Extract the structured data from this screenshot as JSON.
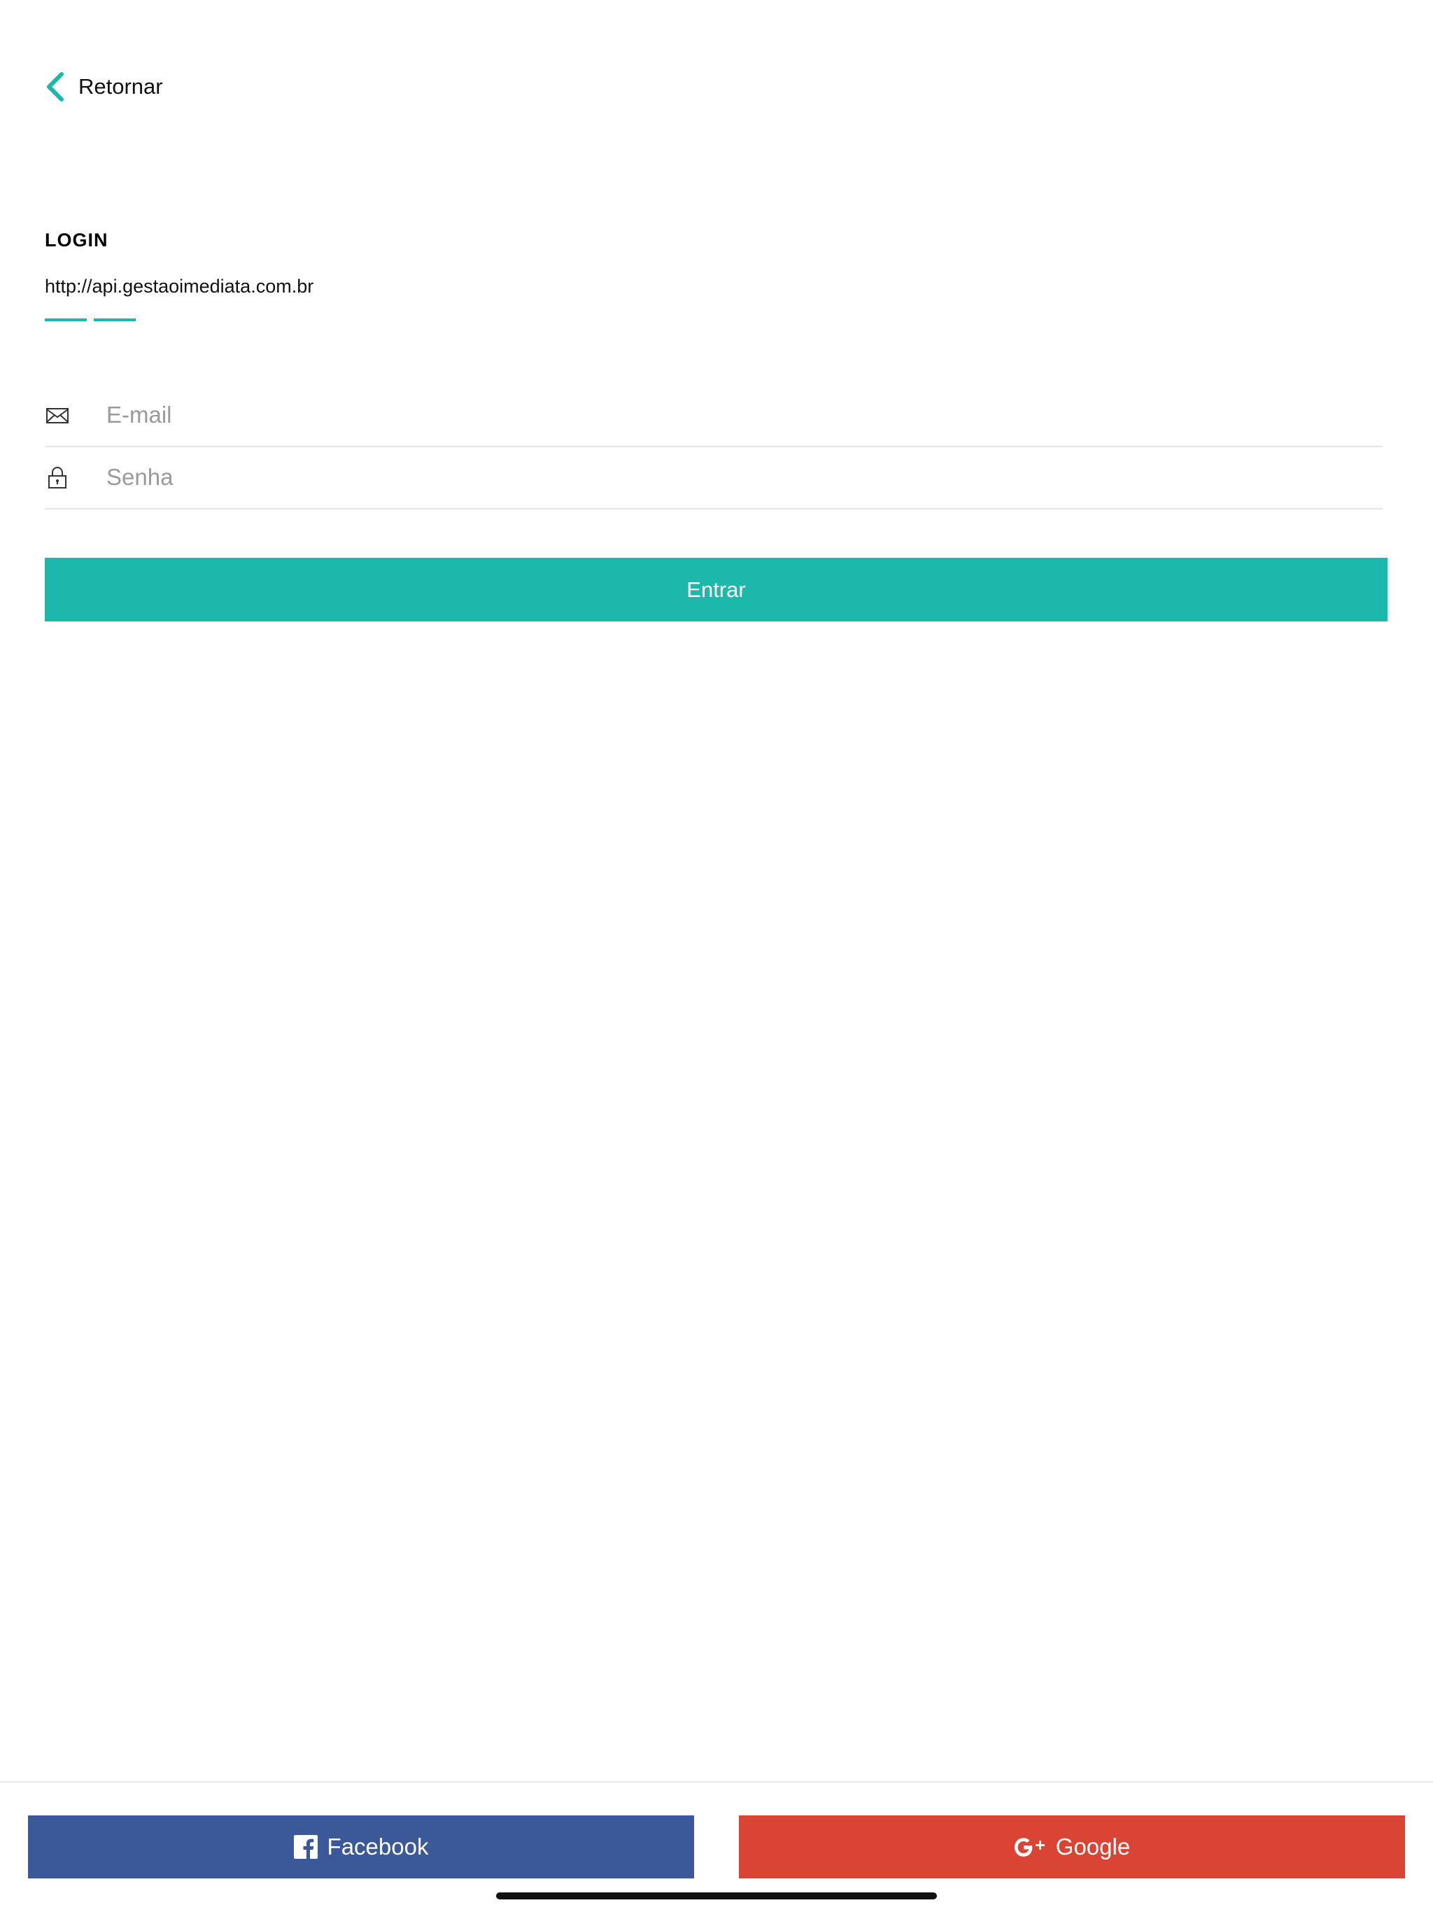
{
  "nav": {
    "back_label": "Retornar"
  },
  "header": {
    "title": "LOGIN",
    "api_url": "http://api.gestaoimediata.com.br"
  },
  "form": {
    "email": {
      "value": "",
      "placeholder": "E-mail",
      "icon": "envelope-icon"
    },
    "password": {
      "value": "",
      "placeholder": "Senha",
      "icon": "lock-icon"
    },
    "submit_label": "Entrar"
  },
  "social": {
    "facebook": {
      "label": "Facebook",
      "icon": "facebook-icon"
    },
    "google": {
      "label": "Google",
      "icon": "google-plus-icon"
    }
  },
  "colors": {
    "accent": "#1db8ac",
    "facebook": "#3b5998",
    "google": "#d94434"
  }
}
